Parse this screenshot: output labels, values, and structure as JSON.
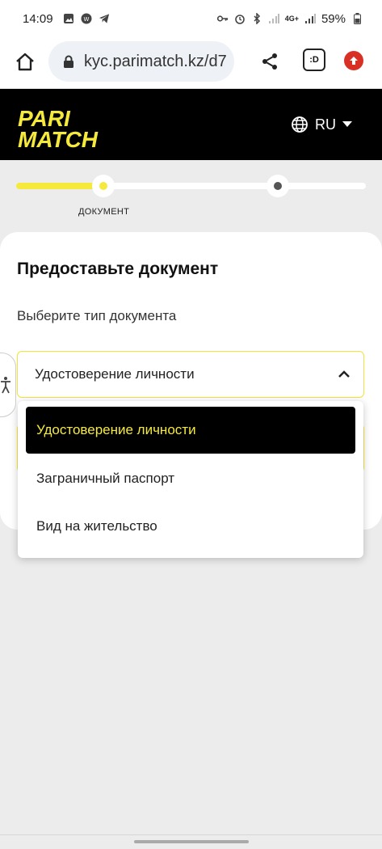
{
  "status_bar": {
    "time": "14:09",
    "network": "4G+",
    "battery": "59%"
  },
  "browser": {
    "url": "kyc.parimatch.kz/d7",
    "tab_indicator": ":D"
  },
  "header": {
    "logo_line1": "PARI",
    "logo_line2": "MATCH",
    "language": "RU"
  },
  "stepper": {
    "current_step_label": "ДОКУМЕНТ",
    "progress": 0.245
  },
  "card": {
    "title": "Предоставьте документ",
    "subtitle": "Выберите тип документа",
    "select_value": "Удостоверение личности"
  },
  "dropdown": {
    "options": [
      {
        "label": "Удостоверение личности",
        "selected": true
      },
      {
        "label": "Заграничный паспорт",
        "selected": false
      },
      {
        "label": "Вид на жительство",
        "selected": false
      }
    ]
  },
  "colors": {
    "accent": "#f5ea3b",
    "header_bg": "#000000",
    "page_bg": "#ececec"
  }
}
